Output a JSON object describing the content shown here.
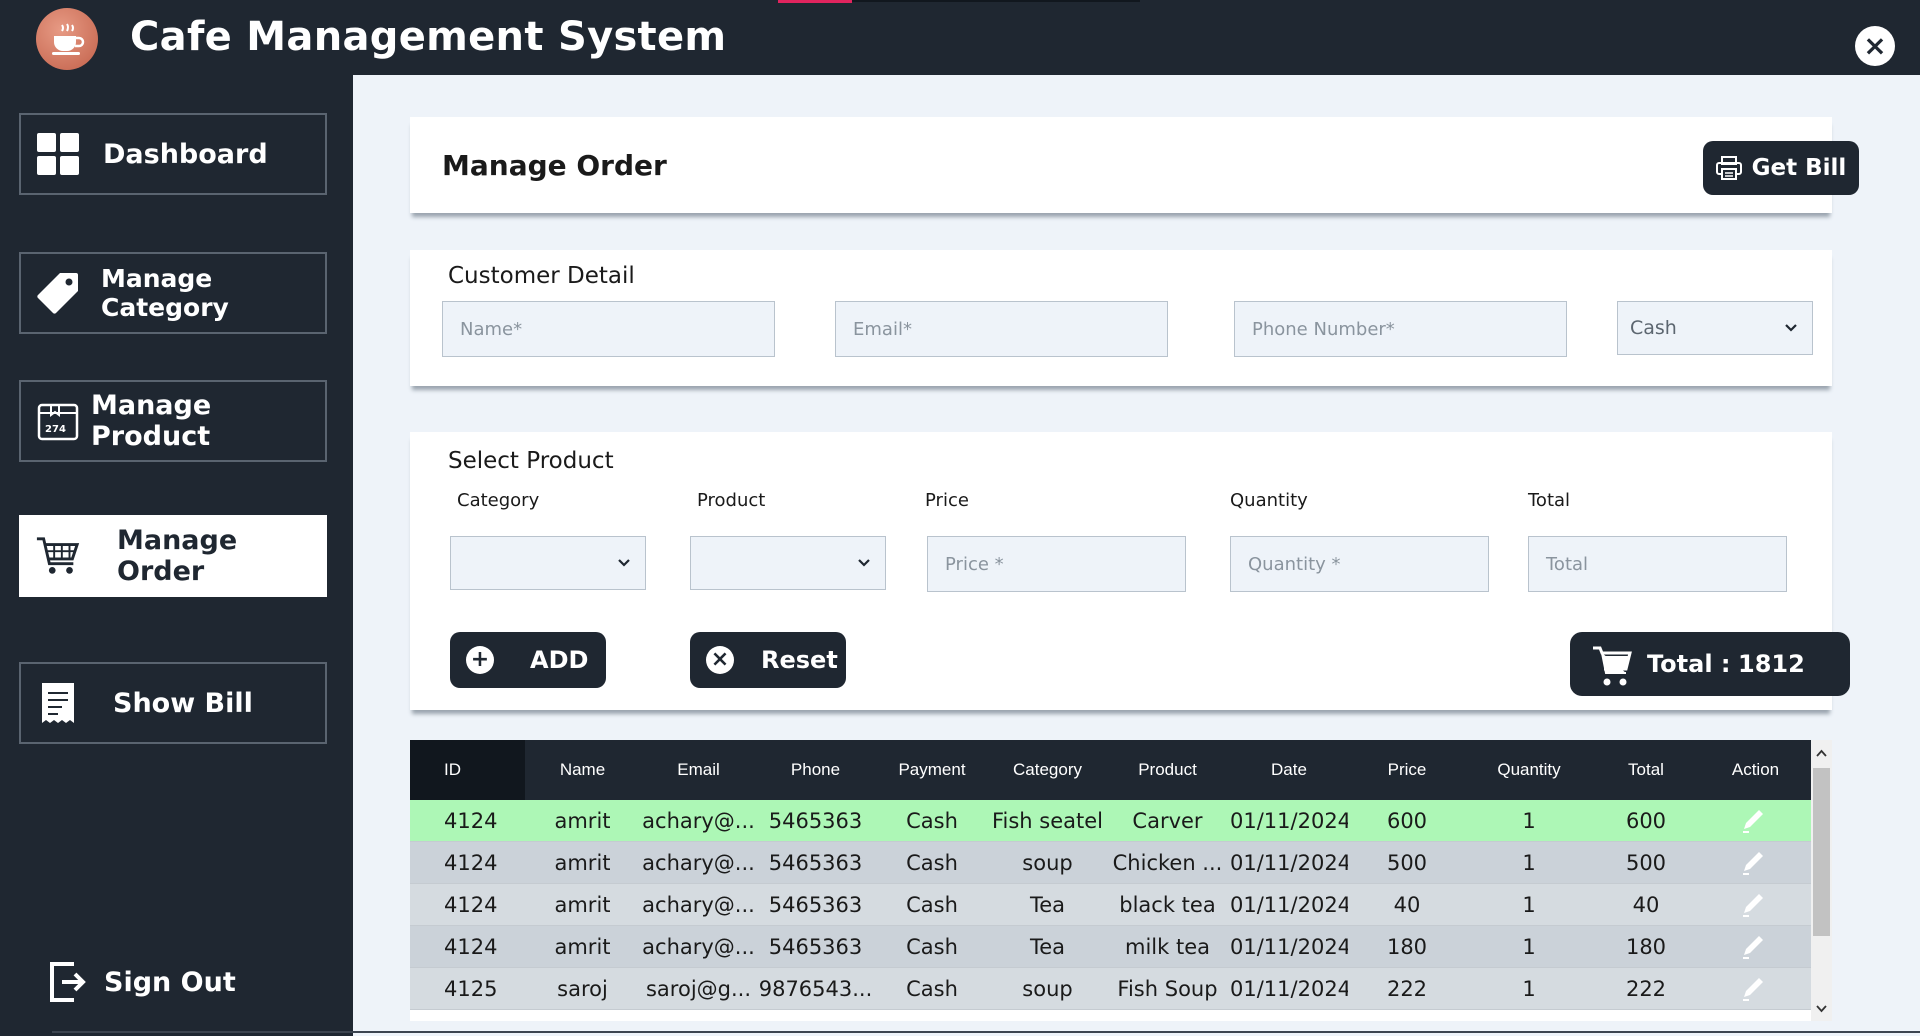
{
  "window": {
    "title": "Cafe Management System",
    "close_glyph": "×"
  },
  "sidebar": {
    "items": [
      {
        "label": "Dashboard",
        "icon": "dashboard-grid-icon",
        "active": false
      },
      {
        "label": "Manage Category",
        "icon": "tag-icon",
        "active": false
      },
      {
        "label": "Manage Product",
        "icon": "product-box-icon",
        "active": false
      },
      {
        "label": "Manage Order",
        "icon": "cart-icon",
        "active": true
      },
      {
        "label": "Show Bill",
        "icon": "bill-icon",
        "active": false
      }
    ],
    "sign_out": "Sign Out"
  },
  "header_card": {
    "title": "Manage Order",
    "get_bill": "Get Bill"
  },
  "customer": {
    "section_title": "Customer Detail",
    "name_placeholder": "Name*",
    "email_placeholder": "Email*",
    "phone_placeholder": "Phone Number*",
    "payment_selected": "Cash"
  },
  "product": {
    "section_title": "Select Product",
    "labels": {
      "category": "Category",
      "product": "Product",
      "price": "Price",
      "quantity": "Quantity",
      "total": "Total"
    },
    "price_placeholder": "Price *",
    "quantity_placeholder": "Quantity *",
    "total_placeholder": "Total",
    "add": "ADD",
    "add_glyph": "+",
    "reset": "Reset",
    "reset_glyph": "×",
    "total_label": "Total :",
    "total_value": "1812"
  },
  "table": {
    "columns": [
      "ID",
      "Name",
      "Email",
      "Phone",
      "Payment",
      "Category",
      "Product",
      "Date",
      "Price",
      "Quantity",
      "Total",
      "Action"
    ],
    "rows": [
      [
        "4124",
        "amrit",
        "achary@...",
        "5465363",
        "Cash",
        "Fish seatel",
        "Carver",
        "01/11/2024",
        "600",
        "1",
        "600"
      ],
      [
        "4124",
        "amrit",
        "achary@...",
        "5465363",
        "Cash",
        "soup",
        "Chicken ...",
        "01/11/2024",
        "500",
        "1",
        "500"
      ],
      [
        "4124",
        "amrit",
        "achary@...",
        "5465363",
        "Cash",
        "Tea",
        "black tea",
        "01/11/2024",
        "40",
        "1",
        "40"
      ],
      [
        "4124",
        "amrit",
        "achary@...",
        "5465363",
        "Cash",
        "Tea",
        "milk tea",
        "01/11/2024",
        "180",
        "1",
        "180"
      ],
      [
        "4125",
        "saroj",
        "saroj@g...",
        "9876543...",
        "Cash",
        "soup",
        "Fish Soup",
        "01/11/2024",
        "222",
        "1",
        "222"
      ]
    ]
  },
  "colors": {
    "dark": "#1f2731",
    "panel_bg": "#eef3f9",
    "selected_row": "#adf7b6",
    "accent": "#e0245e"
  }
}
